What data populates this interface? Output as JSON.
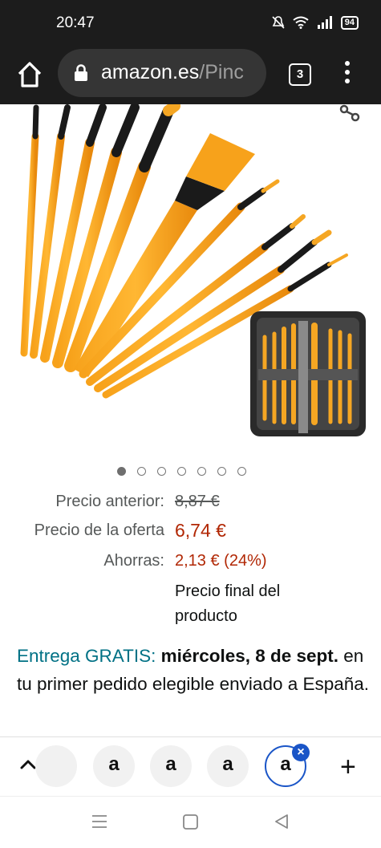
{
  "status_bar": {
    "time": "20:47",
    "battery": "94"
  },
  "toolbar": {
    "url_domain": "amazon.es",
    "url_path": "/Pinc",
    "tab_count": "3"
  },
  "carousel": {
    "total": 7,
    "active_index": 0
  },
  "price": {
    "previous_label": "Precio anterior:",
    "previous_value": "8,87 €",
    "deal_label": "Precio de la oferta",
    "deal_value": "6,74 €",
    "savings_label": "Ahorras:",
    "savings_value": "2,13 € (24%)",
    "final_note": "Precio final del producto"
  },
  "delivery": {
    "prefix": "Entrega GRATIS:",
    "date": "miércoles, 8 de sept.",
    "suffix": " en tu primer pedido elegible enviado a España."
  },
  "tab_strip": {
    "tab_glyph": "a"
  },
  "colors": {
    "price_red": "#b12704",
    "link_teal": "#007185",
    "chrome_dark": "#1c1c1c",
    "tab_blue": "#1a55c7"
  }
}
